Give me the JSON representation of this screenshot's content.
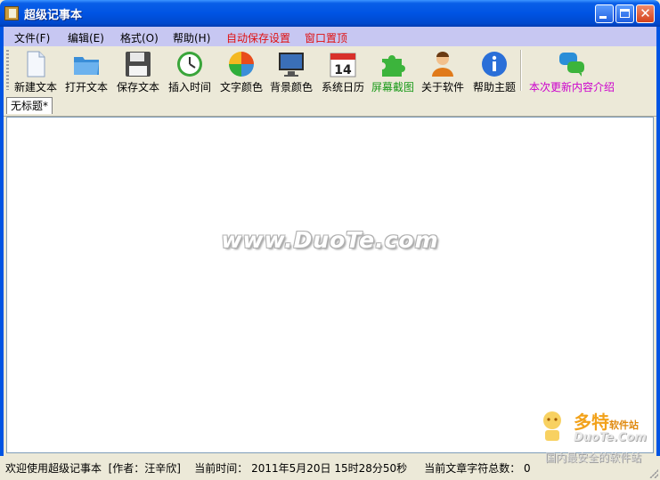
{
  "window": {
    "title": "超级记事本"
  },
  "menu": [
    {
      "label": "文件(F)",
      "name": "menu-file",
      "color": "#000000"
    },
    {
      "label": "编辑(E)",
      "name": "menu-edit",
      "color": "#000000"
    },
    {
      "label": "格式(O)",
      "name": "menu-format",
      "color": "#000000"
    },
    {
      "label": "帮助(H)",
      "name": "menu-help",
      "color": "#000000"
    },
    {
      "label": "自动保存设置",
      "name": "menu-autosave-settings",
      "color": "#e01010"
    },
    {
      "label": "窗口置顶",
      "name": "menu-window-topmost",
      "color": "#e01010"
    }
  ],
  "toolbar": [
    {
      "label": "新建文本",
      "icon": "new-document-icon",
      "color": "#000000"
    },
    {
      "label": "打开文本",
      "icon": "open-folder-icon",
      "color": "#000000"
    },
    {
      "label": "保存文本",
      "icon": "save-floppy-icon",
      "color": "#000000"
    },
    {
      "label": "插入时间",
      "icon": "clock-icon",
      "color": "#000000"
    },
    {
      "label": "文字颜色",
      "icon": "pie-color-icon",
      "color": "#000000"
    },
    {
      "label": "背景颜色",
      "icon": "monitor-icon",
      "color": "#000000"
    },
    {
      "label": "系统日历",
      "icon": "calendar-icon",
      "color": "#000000",
      "badge": "14"
    },
    {
      "label": "屏幕截图",
      "icon": "puzzle-icon",
      "color": "#1a9a1a"
    },
    {
      "label": "关于软件",
      "icon": "user-icon",
      "color": "#000000"
    },
    {
      "label": "帮助主题",
      "icon": "info-icon",
      "color": "#000000"
    },
    {
      "label": "本次更新内容介绍",
      "icon": "chat-bubbles-icon",
      "color": "#cc00cc"
    }
  ],
  "tabs": [
    {
      "label": "无标题*"
    }
  ],
  "editor": {
    "watermark": "www.DuoTe.com"
  },
  "status": {
    "text": "欢迎使用超级记事本  [作者：汪辛欣]    当前时间： 2011年5月20日 15时28分50秒     当前文章字符总数： 0"
  },
  "corner_logo": {
    "brand": "多特",
    "brand_small": "软件站",
    "url": "DuoTe.Com",
    "slogan": "国内最安全的软件站"
  }
}
